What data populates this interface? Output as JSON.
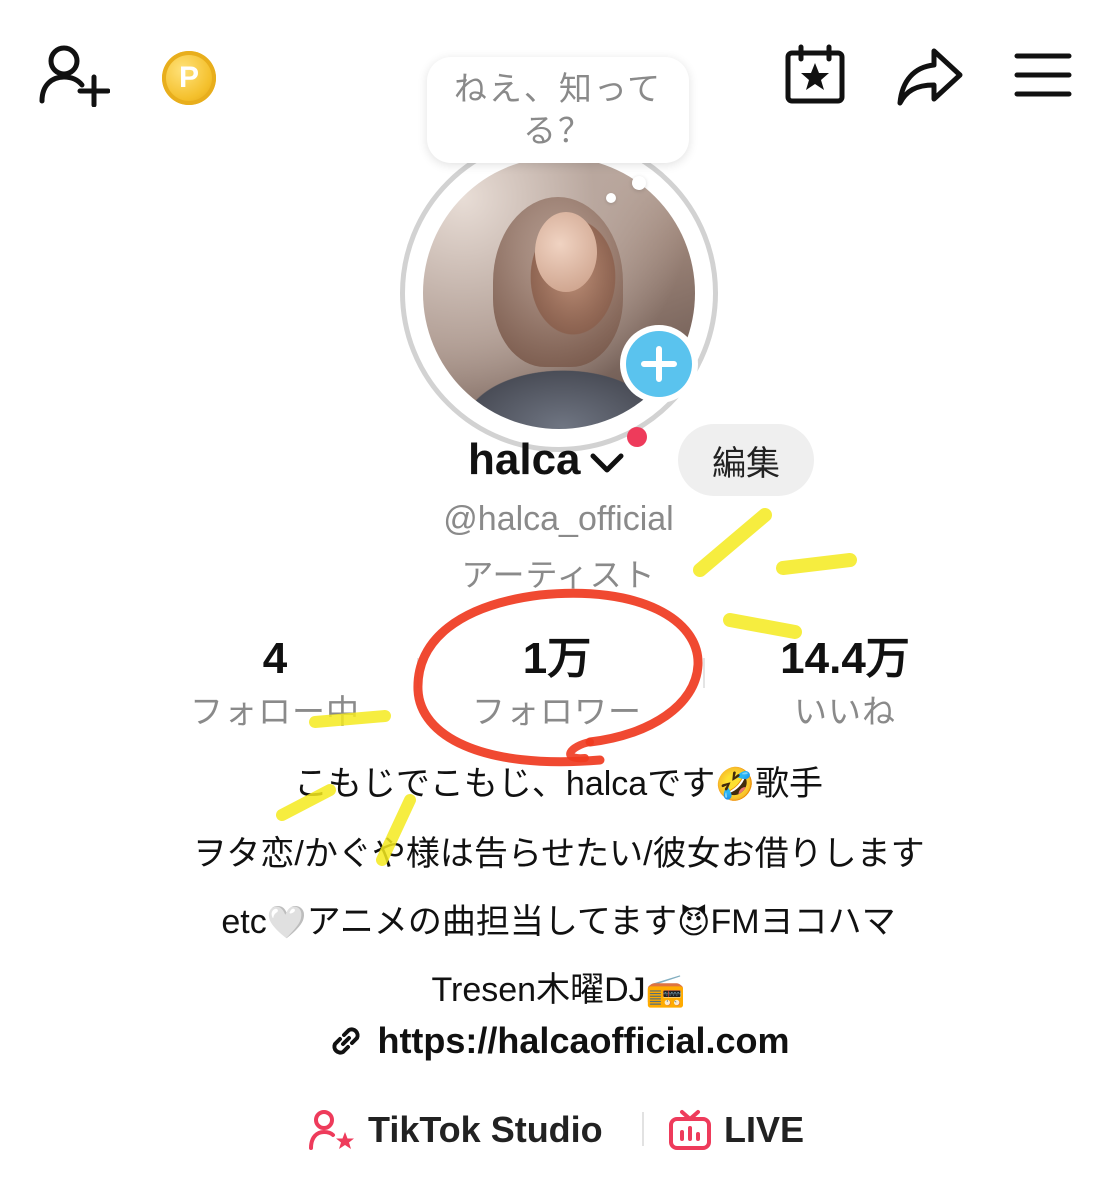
{
  "top_bar": {
    "add_friend_icon": "person-plus-icon",
    "coin_icon": "coin-icon",
    "coin_letter": "P",
    "calendar_icon": "calendar-star-icon",
    "share_icon": "share-arrow-icon",
    "menu_icon": "hamburger-menu-icon"
  },
  "bubble": {
    "line1": "ねえ、知って",
    "line2": "る？"
  },
  "profile": {
    "name": "halca",
    "edit_label": "編集",
    "handle": "@halca_official",
    "category": "アーティスト"
  },
  "stats": [
    {
      "value": "4",
      "label": "フォロー中"
    },
    {
      "value": "1万",
      "label": "フォロワー"
    },
    {
      "value": "14.4万",
      "label": "いいね"
    }
  ],
  "bio": {
    "line1_text": "こもじでこもじ、halcaです",
    "line1_emoji": "🤣",
    "line1_end": "歌手",
    "line2": "ヲタ恋/かぐや様は告らせたい/彼女お借りします",
    "line3_a": "etc",
    "line3_emoji1": "🤍",
    "line3_b": "アニメの曲担当してます",
    "line3_emoji2": "😈",
    "line3_c": "FMヨコハマ",
    "line4_text": "Tresen木曜DJ",
    "line4_emoji": "📻"
  },
  "link": {
    "url": "https://halcaofficial.com",
    "icon": "link-icon"
  },
  "bottom": {
    "studio_label": "TikTok Studio",
    "studio_icon": "person-star-icon",
    "live_label": "LIVE",
    "live_icon": "live-tv-icon"
  },
  "colors": {
    "accent_pink": "#ee3b5b",
    "plus_blue": "#5ac3ee",
    "highlight_yellow": "#f5ea1e",
    "circle_red": "#ef3a1f"
  }
}
